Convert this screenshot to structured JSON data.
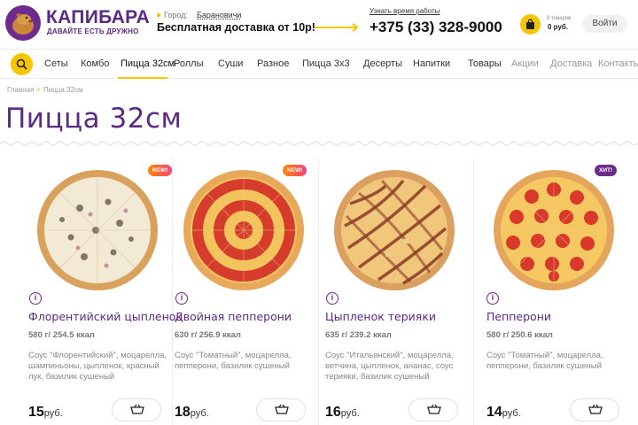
{
  "header": {
    "brand": "КАПИБАРА",
    "slogan": "ДАВАЙТЕ ЕСТЬ ДРУЖНО",
    "city_label": "Город:",
    "city_value": "Барановичи",
    "promo": "Бесплатная доставка от 10р!",
    "worktime_link": "Узнать время работы",
    "phone": "+375 (33) 328-9000",
    "cart_count": "0 товаров",
    "cart_total": "0 руб.",
    "login": "Войти",
    "icons": [
      "capybara-logo-icon",
      "map-pin-icon",
      "arrow-right-icon",
      "shopping-bag-icon"
    ]
  },
  "nav": {
    "items": [
      "Сеты",
      "Комбо",
      "Пицца 32см",
      "Роллы",
      "Суши",
      "Разное",
      "Пицца 3х3",
      "Десерты",
      "Напитки",
      "Товары",
      "Акции",
      "Доставка",
      "Контакты"
    ],
    "active": "Пицца 32см",
    "search_icon": "search-icon"
  },
  "breadcrumb": {
    "home": "Главная",
    "separator": ">",
    "current": "Пицца 32см"
  },
  "page_title": "Пицца 32см",
  "products": [
    {
      "badge": "NEW!",
      "name": "Флорентийский цыпленок",
      "weight": "580 г/ 254.5 ккал",
      "description": "Соус \"Флорентийский\", моцарелла, шампиньоны, цыпленок, красный лук, базилик сушеный",
      "price": "15",
      "currency": "руб."
    },
    {
      "badge": "NEW!",
      "name": "Двойная пепперони",
      "weight": "630 г/ 256.9 ккал",
      "description": "Соус \"Томатный\", моцарелла, пепперони, базилик сушеный",
      "price": "18",
      "currency": "руб."
    },
    {
      "badge": "",
      "name": "Цыпленок терияки",
      "weight": "635 г/ 239.2 ккал",
      "description": "Соус \"Итальянский\", моцарелла, ветчина, цыпленок, ананас, соус терияки, базилик сушеный",
      "price": "16",
      "currency": "руб."
    },
    {
      "badge": "ХИТ!",
      "name": "Пепперони",
      "weight": "580 г/ 250.6 ккал",
      "description": "Соус \"Томатный\", моцарелла, пепперони, базилик сушеный",
      "price": "14",
      "currency": "руб."
    }
  ],
  "colors": {
    "brand_purple": "#5b2a86",
    "accent_yellow": "#f7c600",
    "badge_new": "#ff5a5a",
    "badge_hit": "#6d2b8e"
  }
}
